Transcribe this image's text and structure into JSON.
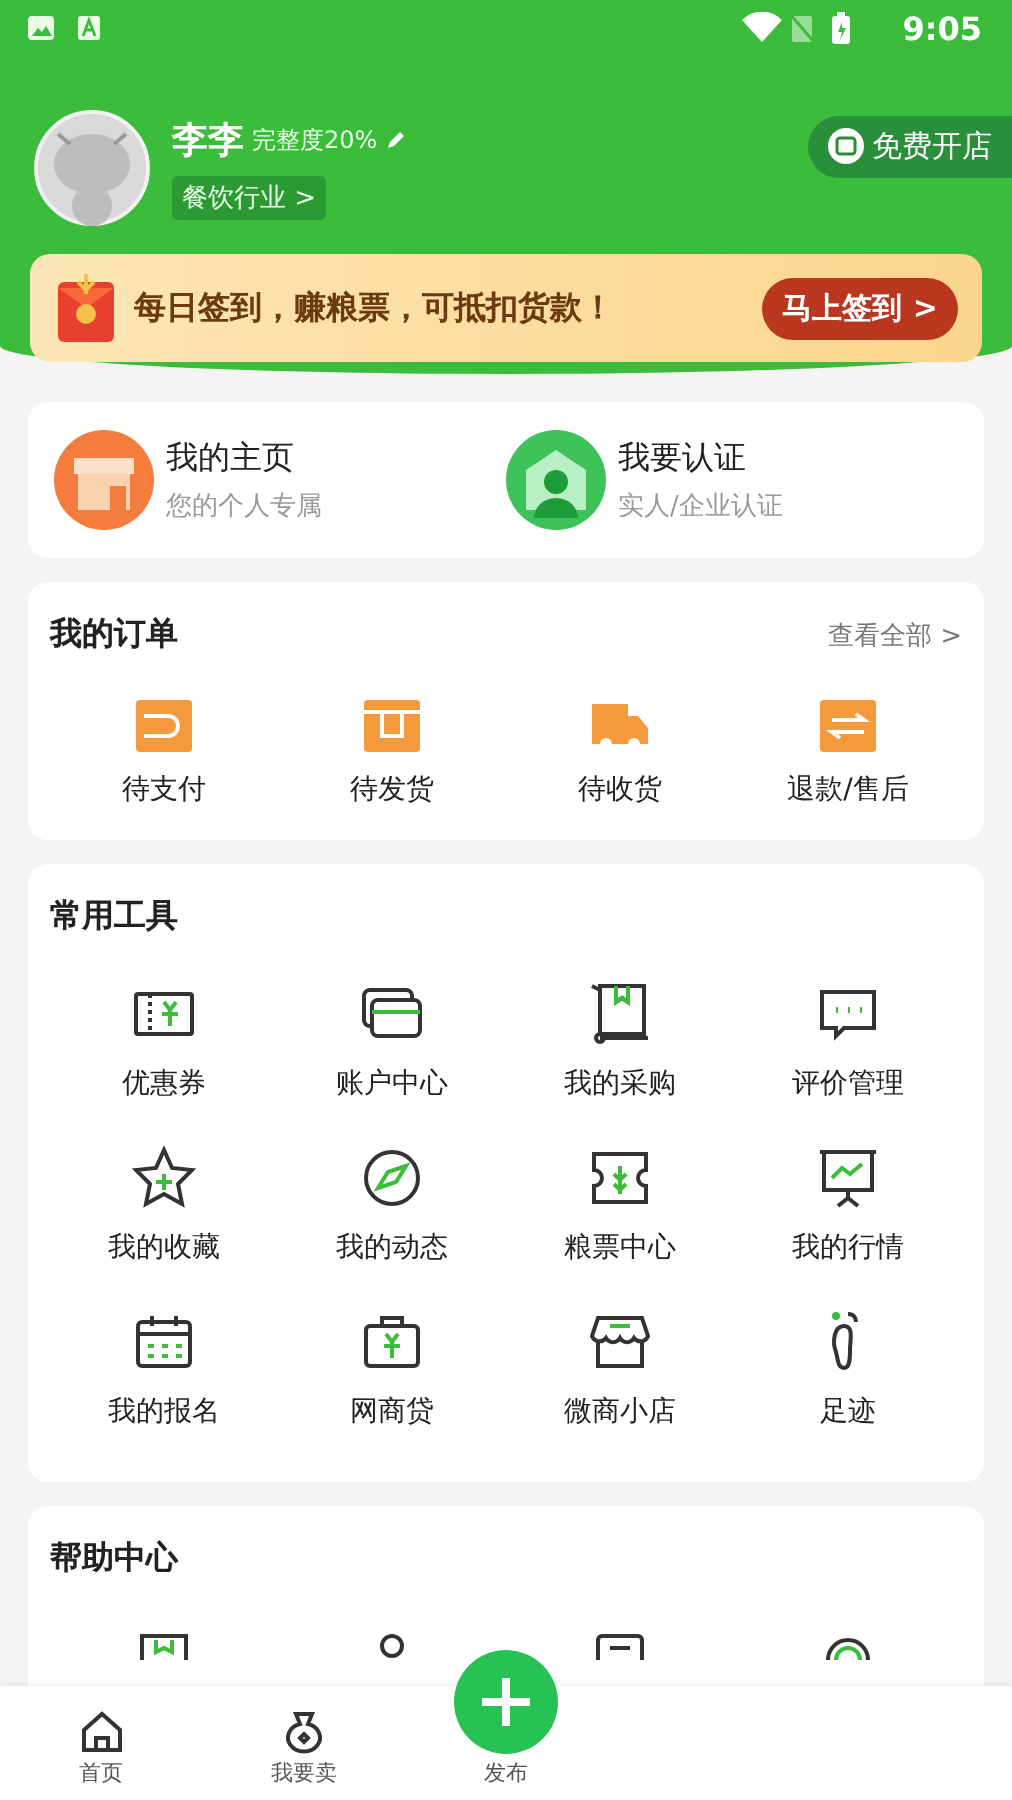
{
  "status_bar": {
    "time": "9:05"
  },
  "profile": {
    "name": "李李",
    "completeness": "完整度20%",
    "industry": "餐饮行业 >",
    "open_store": "免费开店"
  },
  "banner": {
    "text": "每日签到，赚粮票，可抵扣货款！",
    "button": "马上签到 >"
  },
  "shortcuts": [
    {
      "title": "我的主页",
      "subtitle": "您的个人专属"
    },
    {
      "title": "我要认证",
      "subtitle": "实人/企业认证"
    }
  ],
  "orders": {
    "title": "我的订单",
    "view_all": "查看全部 >",
    "items": [
      "待支付",
      "待发货",
      "待收货",
      "退款/售后"
    ]
  },
  "tools": {
    "title": "常用工具",
    "items": [
      "优惠券",
      "账户中心",
      "我的采购",
      "评价管理",
      "我的收藏",
      "我的动态",
      "粮票中心",
      "我的行情",
      "我的报名",
      "网商贷",
      "微商小店",
      "足迹"
    ]
  },
  "help": {
    "title": "帮助中心"
  },
  "bottom_nav": [
    {
      "label": "首页",
      "kind": "tab"
    },
    {
      "label": "我要卖",
      "kind": "tab"
    },
    {
      "label": "发布",
      "kind": "publish"
    }
  ]
}
